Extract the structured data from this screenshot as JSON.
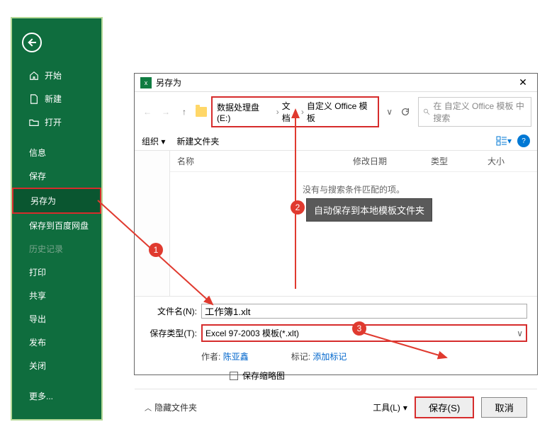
{
  "sidebar": {
    "items": [
      {
        "label": "开始",
        "icon": "home"
      },
      {
        "label": "新建",
        "icon": "file"
      },
      {
        "label": "打开",
        "icon": "folder"
      }
    ],
    "sub_items": [
      {
        "label": "信息"
      },
      {
        "label": "保存"
      },
      {
        "label": "另存为",
        "selected": true
      },
      {
        "label": "保存到百度网盘"
      },
      {
        "label": "历史记录",
        "dim": true
      },
      {
        "label": "打印"
      },
      {
        "label": "共享"
      },
      {
        "label": "导出"
      },
      {
        "label": "发布"
      },
      {
        "label": "关闭"
      },
      {
        "label": "更多..."
      }
    ]
  },
  "dialog": {
    "title": "另存为",
    "breadcrumb": [
      "数据处理盘 (E:)",
      "文档",
      "自定义 Office 模板"
    ],
    "search_placeholder": "在 自定义 Office 模板 中搜索",
    "toolbar": {
      "organize": "组织",
      "new_folder": "新建文件夹"
    },
    "columns": {
      "name": "名称",
      "date": "修改日期",
      "type": "类型",
      "size": "大小"
    },
    "empty_msg": "没有与搜索条件匹配的项。",
    "filename_label": "文件名(N):",
    "filename_value": "工作簿1.xlt",
    "filetype_label": "保存类型(T):",
    "filetype_value": "Excel 97-2003 模板(*.xlt)",
    "author_label": "作者:",
    "author_value": "陈亚鑫",
    "tag_label": "标记:",
    "tag_value": "添加标记",
    "thumb_label": "保存缩略图",
    "hide_folders": "隐藏文件夹",
    "tools": "工具(L)",
    "save": "保存(S)",
    "cancel": "取消"
  },
  "annotations": {
    "b1": "1",
    "b2": "2",
    "b3": "3",
    "tooltip": "自动保存到本地模板文件夹"
  }
}
